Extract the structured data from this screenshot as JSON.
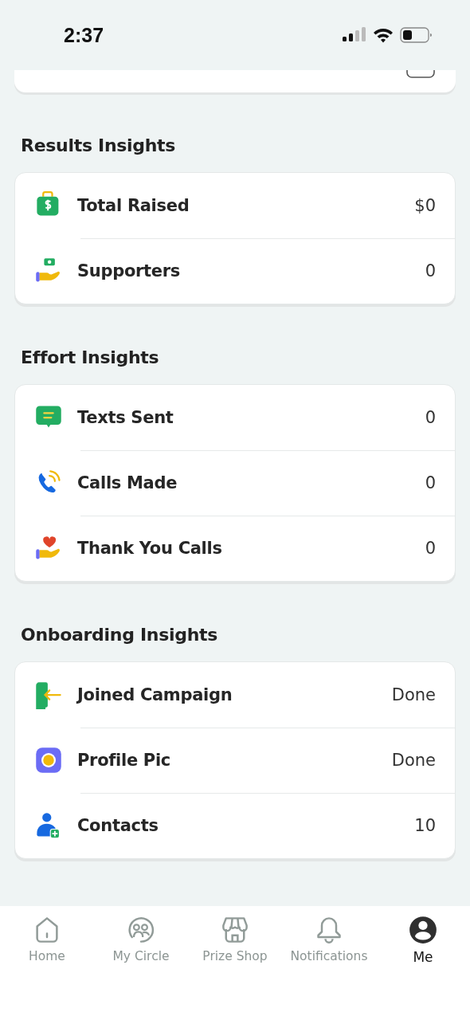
{
  "status_bar": {
    "time": "2:37"
  },
  "sections": [
    {
      "title": "Results Insights",
      "rows": [
        {
          "label": "Total Raised",
          "value": "$0"
        },
        {
          "label": "Supporters",
          "value": "0"
        }
      ]
    },
    {
      "title": "Effort Insights",
      "rows": [
        {
          "label": "Texts Sent",
          "value": "0"
        },
        {
          "label": "Calls Made",
          "value": "0"
        },
        {
          "label": "Thank You Calls",
          "value": "0"
        }
      ]
    },
    {
      "title": "Onboarding Insights",
      "rows": [
        {
          "label": "Joined Campaign",
          "value": "Done"
        },
        {
          "label": "Profile Pic",
          "value": "Done"
        },
        {
          "label": "Contacts",
          "value": "10"
        }
      ]
    }
  ],
  "tab_bar": [
    {
      "label": "Home",
      "selected": false
    },
    {
      "label": "My Circle",
      "selected": false
    },
    {
      "label": "Prize Shop",
      "selected": false
    },
    {
      "label": "Notifications",
      "selected": false
    },
    {
      "label": "Me",
      "selected": true
    }
  ]
}
